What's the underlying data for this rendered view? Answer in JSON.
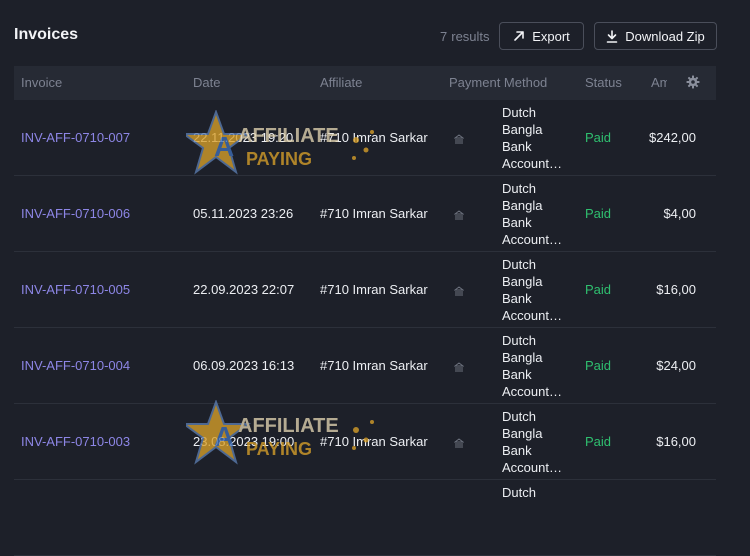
{
  "header": {
    "title": "Invoices",
    "results_count": "7",
    "results_label": "results",
    "export_label": "Export",
    "download_label": "Download Zip"
  },
  "columns": {
    "invoice": "Invoice",
    "date": "Date",
    "affiliate": "Affiliate",
    "payment_method": "Payment Method",
    "status": "Status",
    "amount": "Amount"
  },
  "rows": [
    {
      "invoice": "INV-AFF-0710-007",
      "date": "22.11.2023 19:20",
      "affiliate": "#710 Imran Sarkar",
      "payment_method": "Dutch Bangla Bank Account…",
      "status": "Paid",
      "amount": "$242,00"
    },
    {
      "invoice": "INV-AFF-0710-006",
      "date": "05.11.2023 23:26",
      "affiliate": "#710 Imran Sarkar",
      "payment_method": "Dutch Bangla Bank Account…",
      "status": "Paid",
      "amount": "$4,00"
    },
    {
      "invoice": "INV-AFF-0710-005",
      "date": "22.09.2023 22:07",
      "affiliate": "#710 Imran Sarkar",
      "payment_method": "Dutch Bangla Bank Account…",
      "status": "Paid",
      "amount": "$16,00"
    },
    {
      "invoice": "INV-AFF-0710-004",
      "date": "06.09.2023 16:13",
      "affiliate": "#710 Imran Sarkar",
      "payment_method": "Dutch Bangla Bank Account…",
      "status": "Paid",
      "amount": "$24,00"
    },
    {
      "invoice": "INV-AFF-0710-003",
      "date": "23.08.2023 19:00",
      "affiliate": "#710 Imran Sarkar",
      "payment_method": "Dutch Bangla Bank Account…",
      "status": "Paid",
      "amount": "$16,00"
    },
    {
      "invoice": "",
      "date": "",
      "affiliate": "",
      "payment_method": "Dutch",
      "status": "",
      "amount": ""
    }
  ],
  "watermark": {
    "line1": "AFFILIATE",
    "line2": "PAYING"
  },
  "colors": {
    "background": "#1d2029",
    "header_row": "#262a34",
    "link": "#8d86e6",
    "paid": "#2fbf6f"
  },
  "icons": {
    "export": "arrow-up-right-icon",
    "download": "download-icon",
    "settings": "gear-icon",
    "payment": "bank-icon"
  }
}
